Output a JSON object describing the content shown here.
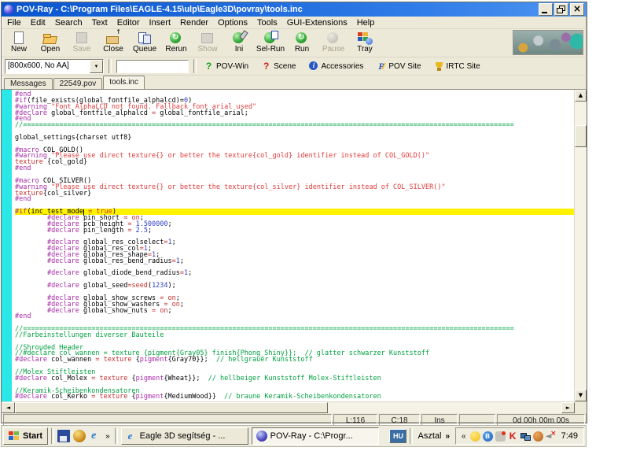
{
  "window": {
    "title": "POV-Ray - C:\\Program Files\\EAGLE-4.15\\ulp\\Eagle3D\\povray\\tools.inc"
  },
  "menu": {
    "items": [
      "File",
      "Edit",
      "Search",
      "Text",
      "Editor",
      "Insert",
      "Render",
      "Options",
      "Tools",
      "GUI-Extensions",
      "Help"
    ]
  },
  "toolbar": {
    "buttons": [
      {
        "label": "New",
        "icon": "new-file",
        "enabled": true
      },
      {
        "label": "Open",
        "icon": "open-folder",
        "enabled": true
      },
      {
        "label": "Save",
        "icon": "save-file",
        "enabled": false
      },
      {
        "label": "Close",
        "icon": "close-file",
        "enabled": true
      },
      {
        "label": "Queue",
        "icon": "queue",
        "enabled": true
      },
      {
        "label": "Rerun",
        "icon": "rerun",
        "enabled": true
      },
      {
        "label": "Show",
        "icon": "show",
        "enabled": false
      },
      {
        "label": "Ini",
        "icon": "ini",
        "enabled": true
      },
      {
        "label": "Sel-Run",
        "icon": "sel-run",
        "enabled": true
      },
      {
        "label": "Run",
        "icon": "run",
        "enabled": true
      },
      {
        "label": "Pause",
        "icon": "pause",
        "enabled": false
      },
      {
        "label": "Tray",
        "icon": "tray",
        "enabled": true
      }
    ]
  },
  "renderbar": {
    "preset_value": "[800x600, No AA]",
    "command_value": "",
    "buttons": [
      {
        "label": "POV-Win",
        "icon": "question-green"
      },
      {
        "label": "Scene",
        "icon": "question-red"
      },
      {
        "label": "Accessories",
        "icon": "info"
      },
      {
        "label": "POV Site",
        "icon": "pov-lightning"
      },
      {
        "label": "IRTC Site",
        "icon": "trophy"
      }
    ]
  },
  "tabs": {
    "items": [
      {
        "label": "Messages",
        "active": false
      },
      {
        "label": "22549.pov",
        "active": false
      },
      {
        "label": "tools.inc",
        "active": true
      }
    ]
  },
  "editor": {
    "highlight_color": "#FFF200",
    "margin_color": "#2BE8E8",
    "lines": [
      {
        "t": [
          [
            "d",
            "#end"
          ]
        ]
      },
      {
        "t": [
          [
            "d",
            "#if"
          ],
          [
            "p",
            "(file_exists(global_fontfile_alphalcd)="
          ],
          [
            "n",
            "0"
          ],
          [
            "p",
            ")"
          ]
        ]
      },
      {
        "t": [
          [
            "d",
            "#warning"
          ],
          [
            "p",
            " "
          ],
          [
            "s",
            "\"Font AlphaLCD not found. Fallback font arial used\""
          ]
        ]
      },
      {
        "t": [
          [
            "d",
            "#declare"
          ],
          [
            "p",
            " global_fontfile_alphalcd "
          ],
          [
            "k",
            "="
          ],
          [
            "p",
            " global_fontfile_arial;"
          ]
        ]
      },
      {
        "t": [
          [
            "d",
            "#end"
          ]
        ]
      },
      {
        "t": [
          [
            "c",
            "//=========================================================================================================================="
          ]
        ]
      },
      {
        "t": []
      },
      {
        "t": [
          [
            "p",
            "global_settings{charset utf8}"
          ]
        ]
      },
      {
        "t": []
      },
      {
        "t": [
          [
            "d",
            "#macro"
          ],
          [
            "p",
            " COL_GOLD()"
          ]
        ]
      },
      {
        "t": [
          [
            "d",
            "#warning"
          ],
          [
            "p",
            " "
          ],
          [
            "s",
            "\"Please use direct texture{} or better the texture{col_gold} identifier instead of COL_GOLD()\""
          ]
        ]
      },
      {
        "t": [
          [
            "k",
            "texture"
          ],
          [
            "p",
            " {col_gold}"
          ]
        ]
      },
      {
        "t": [
          [
            "d",
            "#end"
          ]
        ]
      },
      {
        "t": []
      },
      {
        "t": [
          [
            "d",
            "#macro"
          ],
          [
            "p",
            " COL_SILVER()"
          ]
        ]
      },
      {
        "t": [
          [
            "d",
            "#warning"
          ],
          [
            "p",
            " "
          ],
          [
            "s",
            "\"Please use direct texture{} or better the texture{col_silver} identifier instead of COL_SILVER()\""
          ]
        ]
      },
      {
        "t": [
          [
            "k",
            "texture"
          ],
          [
            "p",
            "{col_silver}"
          ]
        ]
      },
      {
        "t": [
          [
            "d",
            "#end"
          ]
        ]
      },
      {
        "t": []
      },
      {
        "h": 1,
        "t": [
          [
            "d",
            "#if"
          ],
          [
            "p",
            "(inc_test_mode"
          ],
          [
            "cur",
            ""
          ],
          [
            "p",
            " "
          ],
          [
            "k",
            "="
          ],
          [
            "p",
            " "
          ],
          [
            "k",
            "true"
          ],
          [
            "p",
            ")"
          ]
        ]
      },
      {
        "t": [
          [
            "p",
            "        "
          ],
          [
            "d",
            "#declare"
          ],
          [
            "p",
            " pin_short "
          ],
          [
            "k",
            "="
          ],
          [
            "p",
            " "
          ],
          [
            "k",
            "on"
          ],
          [
            "p",
            ";"
          ]
        ]
      },
      {
        "t": [
          [
            "p",
            "        "
          ],
          [
            "d",
            "#declare"
          ],
          [
            "p",
            " pcb_height "
          ],
          [
            "k",
            "="
          ],
          [
            "p",
            " "
          ],
          [
            "n",
            "1.500000"
          ],
          [
            "p",
            ";"
          ]
        ]
      },
      {
        "t": [
          [
            "p",
            "        "
          ],
          [
            "d",
            "#declare"
          ],
          [
            "p",
            " pin_length "
          ],
          [
            "k",
            "="
          ],
          [
            "p",
            " "
          ],
          [
            "n",
            "2.5"
          ],
          [
            "p",
            ";"
          ]
        ]
      },
      {
        "t": []
      },
      {
        "t": [
          [
            "p",
            "        "
          ],
          [
            "d",
            "#declare"
          ],
          [
            "p",
            " global_res_colselect"
          ],
          [
            "k",
            "="
          ],
          [
            "n",
            "1"
          ],
          [
            "p",
            ";"
          ]
        ]
      },
      {
        "t": [
          [
            "p",
            "        "
          ],
          [
            "d",
            "#declare"
          ],
          [
            "p",
            " global_res_col"
          ],
          [
            "k",
            "="
          ],
          [
            "n",
            "1"
          ],
          [
            "p",
            ";"
          ]
        ]
      },
      {
        "t": [
          [
            "p",
            "        "
          ],
          [
            "d",
            "#declare"
          ],
          [
            "p",
            " global_res_shape"
          ],
          [
            "k",
            "="
          ],
          [
            "n",
            "1"
          ],
          [
            "p",
            ";"
          ]
        ]
      },
      {
        "t": [
          [
            "p",
            "        "
          ],
          [
            "d",
            "#declare"
          ],
          [
            "p",
            " global_res_bend_radius"
          ],
          [
            "k",
            "="
          ],
          [
            "n",
            "1"
          ],
          [
            "p",
            ";"
          ]
        ]
      },
      {
        "t": []
      },
      {
        "t": [
          [
            "p",
            "        "
          ],
          [
            "d",
            "#declare"
          ],
          [
            "p",
            " global_diode_bend_radius"
          ],
          [
            "k",
            "="
          ],
          [
            "n",
            "1"
          ],
          [
            "p",
            ";"
          ]
        ]
      },
      {
        "t": []
      },
      {
        "t": [
          [
            "p",
            "        "
          ],
          [
            "d",
            "#declare"
          ],
          [
            "p",
            " global_seed"
          ],
          [
            "k",
            "="
          ],
          [
            "k",
            "seed"
          ],
          [
            "p",
            "("
          ],
          [
            "n",
            "1234"
          ],
          [
            "p",
            ");"
          ]
        ]
      },
      {
        "t": []
      },
      {
        "t": [
          [
            "p",
            "        "
          ],
          [
            "d",
            "#declare"
          ],
          [
            "p",
            " global_show_screws "
          ],
          [
            "k",
            "="
          ],
          [
            "p",
            " "
          ],
          [
            "k",
            "on"
          ],
          [
            "p",
            ";"
          ]
        ]
      },
      {
        "t": [
          [
            "p",
            "        "
          ],
          [
            "d",
            "#declare"
          ],
          [
            "p",
            " global_show_washers "
          ],
          [
            "k",
            "="
          ],
          [
            "p",
            " "
          ],
          [
            "k",
            "on"
          ],
          [
            "p",
            ";"
          ]
        ]
      },
      {
        "t": [
          [
            "p",
            "        "
          ],
          [
            "d",
            "#declare"
          ],
          [
            "p",
            " global_show_nuts "
          ],
          [
            "k",
            "="
          ],
          [
            "p",
            " "
          ],
          [
            "k",
            "on"
          ],
          [
            "p",
            ";"
          ]
        ]
      },
      {
        "t": [
          [
            "d",
            "#end"
          ]
        ]
      },
      {
        "t": []
      },
      {
        "t": [
          [
            "c",
            "//=========================================================================================================================="
          ]
        ]
      },
      {
        "t": [
          [
            "c",
            "//Farbeinstellungen diverser Bauteile"
          ]
        ]
      },
      {
        "t": []
      },
      {
        "t": [
          [
            "c",
            "//Shrouded Header"
          ]
        ]
      },
      {
        "t": [
          [
            "c",
            "//#declare col_wannen = texture {pigment{Gray05} finish{Phong_Shiny}};  // glatter schwarzer Kunststoff"
          ]
        ]
      },
      {
        "t": [
          [
            "d",
            "#declare"
          ],
          [
            "p",
            " col_wannen "
          ],
          [
            "k",
            "="
          ],
          [
            "p",
            " "
          ],
          [
            "k",
            "texture"
          ],
          [
            "p",
            " {"
          ],
          [
            "d",
            "pigment"
          ],
          [
            "p",
            "{Gray70}};  "
          ],
          [
            "c",
            "// hellgrauer Kunststoff"
          ]
        ]
      },
      {
        "t": []
      },
      {
        "t": [
          [
            "c",
            "//Molex Stiftleisten"
          ]
        ]
      },
      {
        "t": [
          [
            "d",
            "#declare"
          ],
          [
            "p",
            " col_Molex "
          ],
          [
            "k",
            "="
          ],
          [
            "p",
            " "
          ],
          [
            "k",
            "texture"
          ],
          [
            "p",
            " {"
          ],
          [
            "d",
            "pigment"
          ],
          [
            "p",
            "{Wheat}};  "
          ],
          [
            "c",
            "// hellbeiger Kunststoff Molex-Stiftleisten"
          ]
        ]
      },
      {
        "t": []
      },
      {
        "t": [
          [
            "c",
            "//Keramik-Scheibenkondensatoren"
          ]
        ]
      },
      {
        "t": [
          [
            "d",
            "#declare"
          ],
          [
            "p",
            " col_Kerko "
          ],
          [
            "k",
            "="
          ],
          [
            "p",
            " "
          ],
          [
            "k",
            "texture"
          ],
          [
            "p",
            " {"
          ],
          [
            "d",
            "pigment"
          ],
          [
            "p",
            "{MediumWood}}  "
          ],
          [
            "c",
            "// braune Keramik-Scheibenkondensatoren"
          ]
        ]
      }
    ]
  },
  "statusbar": {
    "cells": [
      "",
      "L:116",
      "C:18",
      "Ins",
      "",
      "0d 00h 00m 00s"
    ]
  },
  "taskbar": {
    "start_label": "Start",
    "quicklaunch": [
      "floppy",
      "pov-gold",
      "ie"
    ],
    "overflow_chevron": "»",
    "tasks": [
      {
        "label": "Eagle 3D segítség - ...",
        "icon": "ie",
        "active": false
      },
      {
        "label": "POV-Ray - C:\\Progr...",
        "icon": "pov",
        "active": true
      }
    ],
    "language_indicator": "HU",
    "desktop_toolbar_label": "Asztal",
    "desktop_chevron": "»",
    "tray_collapse": "«",
    "tray_icons": [
      "smiley",
      "bluetooth",
      "security-agent",
      "kaspersky",
      "network",
      "updater",
      "volume-muted"
    ],
    "clock": "7:49"
  },
  "colors": {
    "titlebar_blue": "#0A55CE",
    "window_beige": "#ECE9D8",
    "directive_magenta": "#A62CA6",
    "keyword_red": "#C22E2E",
    "string_red": "#E13A3A",
    "comment_green": "#00A040",
    "number_blue": "#3141C4"
  }
}
